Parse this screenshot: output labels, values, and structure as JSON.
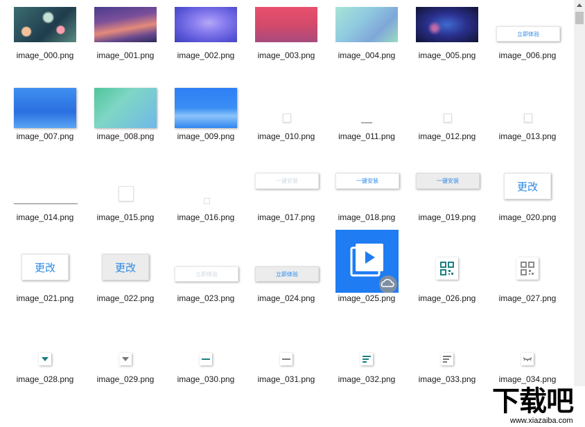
{
  "files": [
    {
      "name": "image_000.png",
      "thumb": "photo-bokeh-teal"
    },
    {
      "name": "image_001.png",
      "thumb": "photo-sunset-purple"
    },
    {
      "name": "image_002.png",
      "thumb": "photo-blue-violet"
    },
    {
      "name": "image_003.png",
      "thumb": "photo-pink-gradient"
    },
    {
      "name": "image_004.png",
      "thumb": "photo-lowpoly-mint"
    },
    {
      "name": "image_005.png",
      "thumb": "photo-galaxy"
    },
    {
      "name": "image_006.png",
      "thumb": "button-try-now",
      "text": "立即体验"
    },
    {
      "name": "image_007.png",
      "thumb": "screen-blue-login"
    },
    {
      "name": "image_008.png",
      "thumb": "screen-isometric-green"
    },
    {
      "name": "image_009.png",
      "thumb": "screen-blue-waves"
    },
    {
      "name": "image_010.png",
      "thumb": "small-square"
    },
    {
      "name": "image_011.png",
      "thumb": "tiny-line"
    },
    {
      "name": "image_012.png",
      "thumb": "small-square"
    },
    {
      "name": "image_013.png",
      "thumb": "small-square"
    },
    {
      "name": "image_014.png",
      "thumb": "long-line"
    },
    {
      "name": "image_015.png",
      "thumb": "small-square-lg"
    },
    {
      "name": "image_016.png",
      "thumb": "small-square-sm"
    },
    {
      "name": "image_017.png",
      "thumb": "button-install-faint",
      "text": "一键安装"
    },
    {
      "name": "image_018.png",
      "thumb": "button-install-blue",
      "text": "一键安装"
    },
    {
      "name": "image_019.png",
      "thumb": "button-install-gray",
      "text": "一键安装"
    },
    {
      "name": "image_020.png",
      "thumb": "button-change-blue",
      "text": "更改"
    },
    {
      "name": "image_021.png",
      "thumb": "button-change-blue",
      "text": "更改"
    },
    {
      "name": "image_022.png",
      "thumb": "button-change-gray",
      "text": "更改"
    },
    {
      "name": "image_023.png",
      "thumb": "button-try-faint",
      "text": "立即体验"
    },
    {
      "name": "image_024.png",
      "thumb": "button-try-gray",
      "text": "立即体验"
    },
    {
      "name": "image_025.png",
      "thumb": "app-video-blue"
    },
    {
      "name": "image_026.png",
      "thumb": "qr-icon-teal"
    },
    {
      "name": "image_027.png",
      "thumb": "qr-icon-gray"
    },
    {
      "name": "image_028.png",
      "thumb": "dropdown-teal"
    },
    {
      "name": "image_029.png",
      "thumb": "dropdown-gray"
    },
    {
      "name": "image_030.png",
      "thumb": "minimize-teal"
    },
    {
      "name": "image_031.png",
      "thumb": "minimize-gray"
    },
    {
      "name": "image_032.png",
      "thumb": "menu-teal"
    },
    {
      "name": "image_033.png",
      "thumb": "menu-gray"
    },
    {
      "name": "image_034.png",
      "thumb": "eye-closed-gray"
    }
  ],
  "watermark": {
    "logo_text": "下载吧",
    "url_text": "www.xiazaiba.com"
  },
  "colors": {
    "accent_blue": "#1e88e5",
    "accent_teal": "#1b7f7f",
    "icon_gray": "#8a8a8a"
  }
}
